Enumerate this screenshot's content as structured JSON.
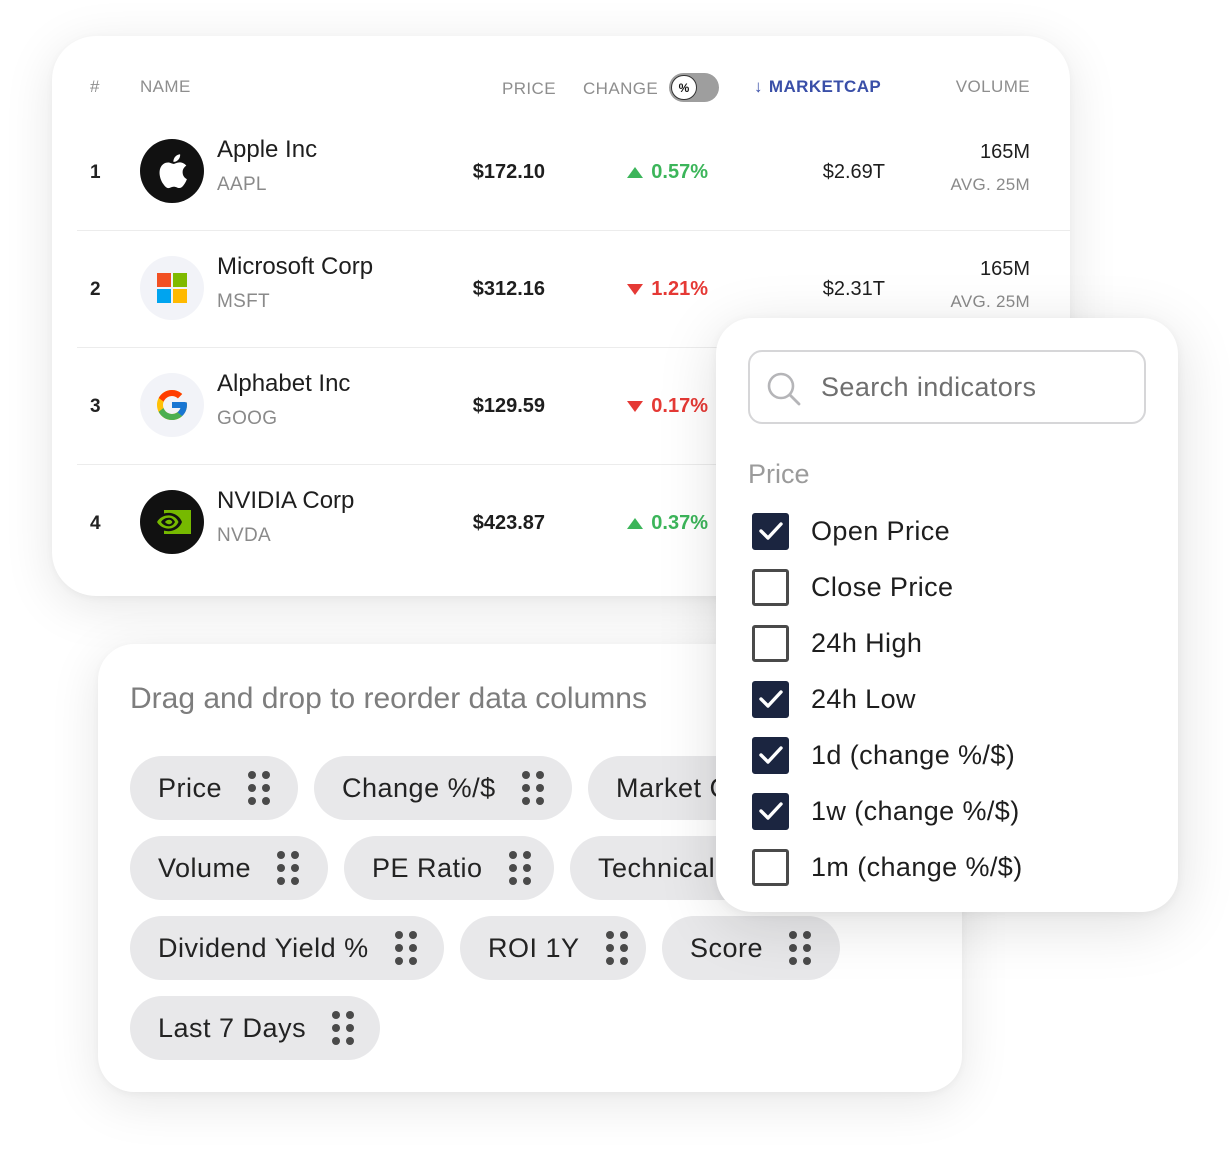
{
  "table": {
    "headers": {
      "num": "#",
      "name": "NAME",
      "price": "PRICE",
      "change": "CHANGE",
      "toggle": "%",
      "marketcap_arrow": "↓",
      "marketcap": "MARKETCAP",
      "volume": "VOLUME"
    },
    "rows": [
      {
        "rank": "1",
        "name": "Apple Inc",
        "ticker": "AAPL",
        "price": "$172.10",
        "change": "0.57%",
        "direction": "up",
        "marketcap": "$2.69T",
        "volume": "165M",
        "avg": "AVG. 25M",
        "logo": "apple-logo-icon"
      },
      {
        "rank": "2",
        "name": "Microsoft Corp",
        "ticker": "MSFT",
        "price": "$312.16",
        "change": "1.21%",
        "direction": "down",
        "marketcap": "$2.31T",
        "volume": "165M",
        "avg": "AVG. 25M",
        "logo": "microsoft-logo-icon"
      },
      {
        "rank": "3",
        "name": "Alphabet Inc",
        "ticker": "GOOG",
        "price": "$129.59",
        "change": "0.17%",
        "direction": "down",
        "logo": "google-logo-icon"
      },
      {
        "rank": "4",
        "name": "NVIDIA Corp",
        "ticker": "NVDA",
        "price": "$423.87",
        "change": "0.37%",
        "direction": "up",
        "logo": "nvidia-logo-icon"
      }
    ]
  },
  "columns": {
    "title": "Drag and drop to reorder data columns",
    "chips": [
      {
        "label": "Price"
      },
      {
        "label": "Change %/$"
      },
      {
        "label": "Market Cap"
      },
      {
        "label": "Volume"
      },
      {
        "label": "PE Ratio"
      },
      {
        "label": "Technical"
      },
      {
        "label": "Dividend Yield %"
      },
      {
        "label": "ROI 1Y"
      },
      {
        "label": "Score"
      },
      {
        "label": "Last 7 Days"
      }
    ]
  },
  "indicators": {
    "search_placeholder": "Search indicators",
    "section": "Price",
    "options": [
      {
        "label": "Open Price",
        "checked": true
      },
      {
        "label": "Close Price",
        "checked": false
      },
      {
        "label": "24h High",
        "checked": false
      },
      {
        "label": "24h Low",
        "checked": true
      },
      {
        "label": "1d (change %/$)",
        "checked": true
      },
      {
        "label": "1w (change %/$)",
        "checked": true
      },
      {
        "label": "1m (change %/$)",
        "checked": false
      }
    ]
  },
  "colors": {
    "up": "#3cb55a",
    "down": "#e53935",
    "accent": "#3a4fa8",
    "checkbox": "#1b2540"
  }
}
